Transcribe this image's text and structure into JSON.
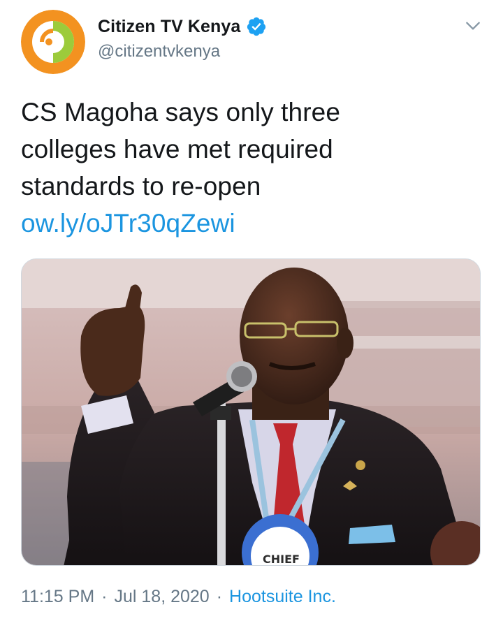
{
  "account": {
    "display_name": "Citizen TV Kenya",
    "handle": "@citizentvkenya",
    "verified": true,
    "avatar_icon": "citizen-tv-logo",
    "avatar_colors": {
      "outer": "#f39220",
      "inner": "#9ccb3b",
      "center": "#ffffff"
    }
  },
  "menu": {
    "icon": "chevron-down-icon"
  },
  "tweet": {
    "lines": [
      "CS Magoha says only three",
      "colleges have met required",
      "standards to re-open"
    ],
    "link": "ow.ly/oJTr30qZewi"
  },
  "media": {
    "badge_text": "CHIEF"
  },
  "footer": {
    "time": "11:15 PM",
    "separator": "·",
    "date": "Jul 18, 2020",
    "source": "Hootsuite Inc."
  },
  "colors": {
    "link": "#1b95e0",
    "secondary_text": "#657786",
    "primary_text": "#14171a",
    "verified_badge": "#1da1f2"
  }
}
